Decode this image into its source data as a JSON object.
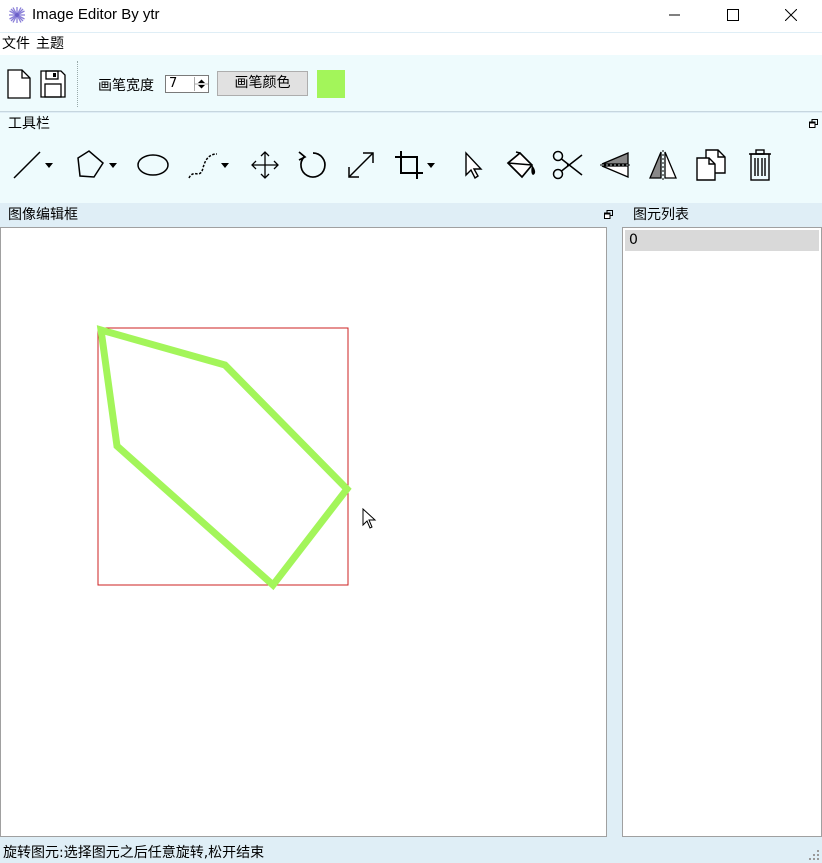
{
  "window": {
    "title": "Image Editor By ytr",
    "icon": "flower-icon"
  },
  "menubar": {
    "items": [
      {
        "label": "文件"
      },
      {
        "label": "主题"
      }
    ]
  },
  "toolbar": {
    "new_icon": "new-file-icon",
    "save_icon": "save-icon",
    "pen_width_label": "画笔宽度",
    "pen_width_value": "7",
    "pen_color_button": "画笔颜色",
    "pen_color": "#a3f55a"
  },
  "toolbox": {
    "title": "工具栏",
    "tools": [
      {
        "name": "line-tool",
        "icon": "line-icon",
        "dropdown": true
      },
      {
        "name": "polygon-tool",
        "icon": "polygon-icon",
        "dropdown": true
      },
      {
        "name": "ellipse-tool",
        "icon": "ellipse-icon",
        "dropdown": false
      },
      {
        "name": "curve-tool",
        "icon": "curve-icon",
        "dropdown": true
      },
      {
        "name": "move-tool",
        "icon": "move-icon",
        "dropdown": false
      },
      {
        "name": "rotate-tool",
        "icon": "rotate-icon",
        "dropdown": false
      },
      {
        "name": "scale-tool",
        "icon": "scale-icon",
        "dropdown": false
      },
      {
        "name": "crop-tool",
        "icon": "crop-icon",
        "dropdown": true
      },
      {
        "name": "select-tool",
        "icon": "cursor-icon",
        "dropdown": false
      },
      {
        "name": "fill-tool",
        "icon": "paint-bucket-icon",
        "dropdown": false
      },
      {
        "name": "cut-tool",
        "icon": "scissors-icon",
        "dropdown": false
      },
      {
        "name": "flip-vertical-tool",
        "icon": "flip-vertical-icon",
        "dropdown": false
      },
      {
        "name": "flip-horizontal-tool",
        "icon": "flip-horizontal-icon",
        "dropdown": false
      },
      {
        "name": "copy-tool",
        "icon": "copy-icon",
        "dropdown": false
      },
      {
        "name": "delete-tool",
        "icon": "trash-icon",
        "dropdown": false
      }
    ]
  },
  "editor": {
    "title": "图像编辑框",
    "shape": {
      "type": "polygon",
      "stroke_color": "#a3f55a",
      "bounding_box_color": "#cc2222"
    }
  },
  "shape_list": {
    "title": "图元列表",
    "items": [
      "0"
    ]
  },
  "status": {
    "text": "旋转图元:选择图元之后任意旋转,松开结束"
  },
  "colors": {
    "background": "#dfeef6",
    "panel": "#eefbfd",
    "selected_row": "#d9d9d9"
  }
}
